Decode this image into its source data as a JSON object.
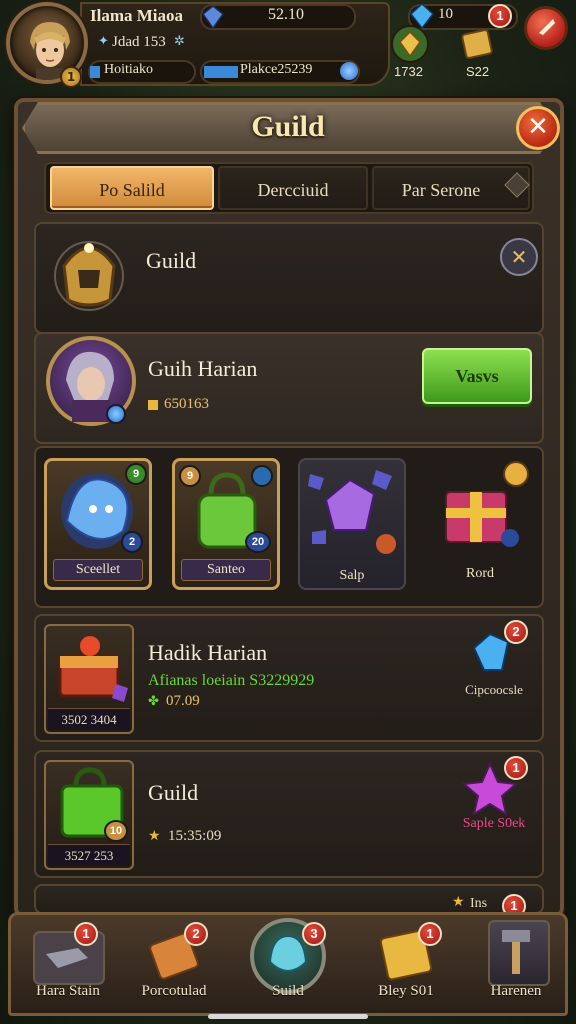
{
  "player": {
    "name": "Ilama Miaoa",
    "sub_line": "Jdad 153",
    "label_left": "Hoitiako",
    "label_right": "Plakce25239",
    "level": "1"
  },
  "currency": {
    "gems": "52.10",
    "count": "10",
    "res1": "1732",
    "res2": "S22"
  },
  "notifications": {
    "top_gem": "1"
  },
  "panel": {
    "title": "Guild",
    "close_label": "✕"
  },
  "tabs": [
    {
      "label": "Po Salild",
      "active": true
    },
    {
      "label": "Dercciuid",
      "active": false
    },
    {
      "label": "Par Serone",
      "active": false
    }
  ],
  "guild_card": {
    "title": "Guild",
    "close_label": "✕"
  },
  "member": {
    "name": "Guih Harian",
    "value": "650163",
    "button_label": "Vasvs"
  },
  "items": [
    {
      "label": "Sceellet",
      "badge_top": "9",
      "badge_bottom": "2"
    },
    {
      "label": "Santeo",
      "badge_top": "9",
      "badge_bottom": "20"
    },
    {
      "label": "Salp"
    },
    {
      "label": "Rord"
    }
  ],
  "rows": [
    {
      "title": "Hadik Harian",
      "subtitle": "Afianas loeiain S3229929",
      "value": "07.09",
      "foot": "3502 3404",
      "side_label": "Cipcoocsle",
      "badge": "2"
    },
    {
      "title": "Guild",
      "value": "15:35:09",
      "foot": "3527 253",
      "item_badge": "10",
      "side_label": "Saple S0ek",
      "badge": "1"
    }
  ],
  "partial_row": {
    "label": "Ins",
    "badge": "1"
  },
  "nav": [
    {
      "label": "Hara Stain",
      "badge": "1"
    },
    {
      "label": "Porcotulad",
      "badge": "2"
    },
    {
      "label": "Suild",
      "badge": "3"
    },
    {
      "label": "Bley S01",
      "badge": "1"
    },
    {
      "label": "Harenen"
    }
  ],
  "colors": {
    "accent_green": "#5cc02a",
    "badge_red": "#d23a2a",
    "tab_active": "#e0a050",
    "frame_gold": "#c8a05a"
  }
}
